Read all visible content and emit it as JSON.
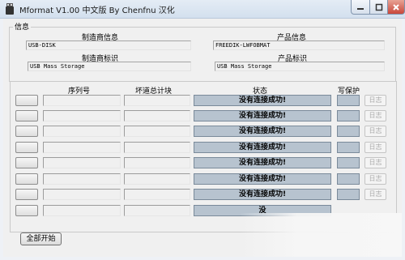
{
  "window": {
    "title": "Mformat V1.00 中文版 By Chenfnu 汉化",
    "icon": "usb-drive-icon"
  },
  "info": {
    "group_label": "信息",
    "vendor_info_label": "制造商信息",
    "vendor_info_value": "USB-DISK",
    "product_info_label": "产品信息",
    "product_info_value": "FREEDIK-LWFOBMAT",
    "vendor_id_label": "制造商标识",
    "vendor_id_value": "USB Mass Storage",
    "product_id_label": "产品标识",
    "product_id_value": "USB Mass Storage"
  },
  "table": {
    "columns": {
      "serial": "序列号",
      "bad_blocks": "坏道总计块",
      "status": "状态",
      "write_protect": "写保护"
    },
    "rows": [
      {
        "status": "没有连接成功!",
        "log": "日志"
      },
      {
        "status": "没有连接成功!",
        "log": "日志"
      },
      {
        "status": "没有连接成功!",
        "log": "日志"
      },
      {
        "status": "没有连接成功!",
        "log": "日志"
      },
      {
        "status": "没有连接成功!",
        "log": "日志"
      },
      {
        "status": "没有连接成功!",
        "log": "日志"
      },
      {
        "status": "没有连接成功!",
        "log": "日志"
      },
      {
        "status": "没",
        "log": ""
      }
    ]
  },
  "footer": {
    "start_all_label": "全部开始"
  }
}
